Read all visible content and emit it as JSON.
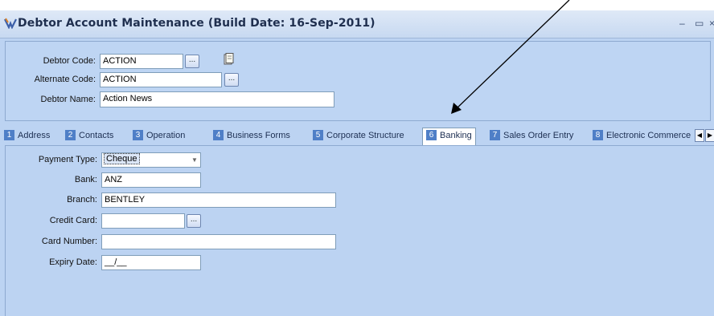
{
  "window": {
    "title": "Debtor Account Maintenance (Build Date: 16-Sep-2011)",
    "controls": {
      "minimize": "–",
      "maximize": "▭",
      "close": "×"
    }
  },
  "header": {
    "debtor_code": {
      "label": "Debtor Code:",
      "value": "ACTION",
      "lookup": "..."
    },
    "alternate_code": {
      "label": "Alternate Code:",
      "value": "ACTION",
      "lookup": "..."
    },
    "debtor_name": {
      "label": "Debtor Name:",
      "value": "Action News"
    }
  },
  "tabs": [
    {
      "num": "1",
      "label": "Address"
    },
    {
      "num": "2",
      "label": "Contacts"
    },
    {
      "num": "3",
      "label": "Operation"
    },
    {
      "num": "4",
      "label": "Business Forms"
    },
    {
      "num": "5",
      "label": "Corporate Structure"
    },
    {
      "num": "6",
      "label": "Banking"
    },
    {
      "num": "7",
      "label": "Sales Order Entry"
    },
    {
      "num": "8",
      "label": "Electronic Commerce"
    }
  ],
  "active_tab": "Banking",
  "banking": {
    "payment_type": {
      "label": "Payment Type:",
      "value": "Cheque"
    },
    "bank": {
      "label": "Bank:",
      "value": "ANZ"
    },
    "branch": {
      "label": "Branch:",
      "value": "BENTLEY"
    },
    "credit_card": {
      "label": "Credit Card:",
      "value": "",
      "lookup": "..."
    },
    "card_number": {
      "label": "Card Number:",
      "value": ""
    },
    "expiry_date": {
      "label": "Expiry Date:",
      "value": "__/__"
    }
  },
  "colors": {
    "window_bg": "#bcd3f2",
    "title_text": "#1f2f4f",
    "tab_number_bg": "#4f7fc7",
    "field_border": "#7f9db9"
  }
}
